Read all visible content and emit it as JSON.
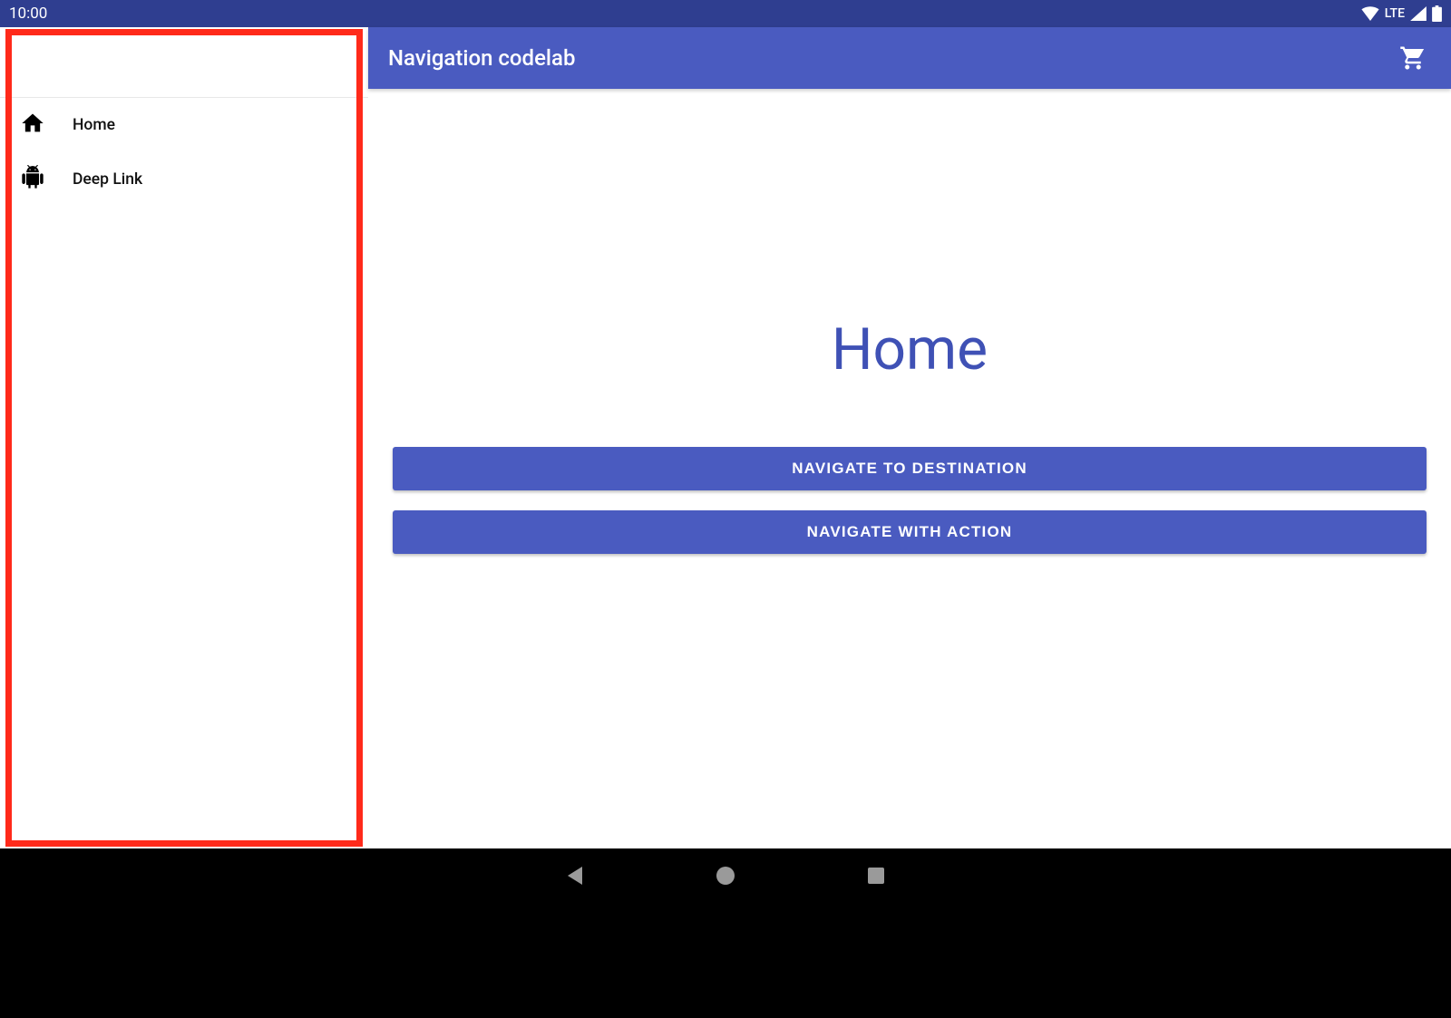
{
  "status": {
    "time": "10:00",
    "network_label": "LTE"
  },
  "app_bar": {
    "title": "Navigation codelab"
  },
  "sidebar": {
    "items": [
      {
        "icon": "home",
        "label": "Home"
      },
      {
        "icon": "android",
        "label": "Deep Link"
      }
    ]
  },
  "main": {
    "heading": "Home",
    "buttons": [
      "Navigate to Destination",
      "Navigate with Action"
    ]
  },
  "colors": {
    "primary": "#4a5bc0",
    "primary_dark": "#2f3e90",
    "accent_text": "#3f51b5",
    "highlight": "#ff2a1a"
  }
}
